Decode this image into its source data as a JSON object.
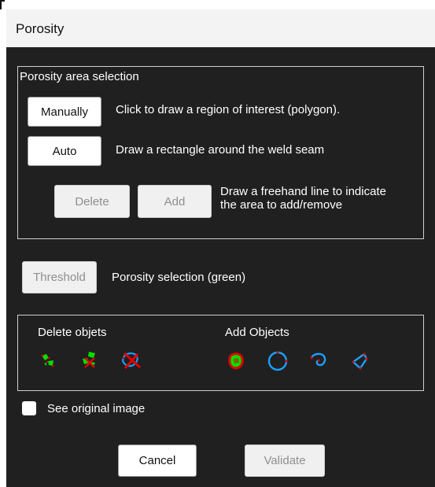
{
  "window": {
    "title": "Porosity"
  },
  "area_selection": {
    "group_label": "Porosity area selection",
    "manual_button": "Manually",
    "manual_desc": "Click to draw a region of interest (polygon).",
    "auto_button": "Auto",
    "auto_desc": "Draw a rectangle around the weld seam",
    "delete_button": "Delete",
    "add_button": "Add",
    "freehand_desc_line1": "Draw a freehand line to indicate",
    "freehand_desc_line2": "the area to add/remove"
  },
  "threshold": {
    "button": "Threshold",
    "desc": "Porosity selection (green)"
  },
  "objects": {
    "delete_label": "Delete objets",
    "add_label": "Add Objects",
    "delete_icons": [
      "delete-small-objects-icon",
      "delete-selected-objects-icon",
      "delete-crossed-outline-icon"
    ],
    "add_icons": [
      "add-freehand-blob-icon",
      "add-circle-icon",
      "add-freehand-curve-icon",
      "add-polygon-icon"
    ]
  },
  "see_original": {
    "label": "See original image",
    "checked": false
  },
  "footer": {
    "cancel": "Cancel",
    "validate": "Validate"
  },
  "colors": {
    "dialog_bg": "#202020",
    "titlebar_bg": "#f3f3f3",
    "green": "#00e000",
    "red": "#e00000",
    "blue": "#1aa0ff"
  }
}
